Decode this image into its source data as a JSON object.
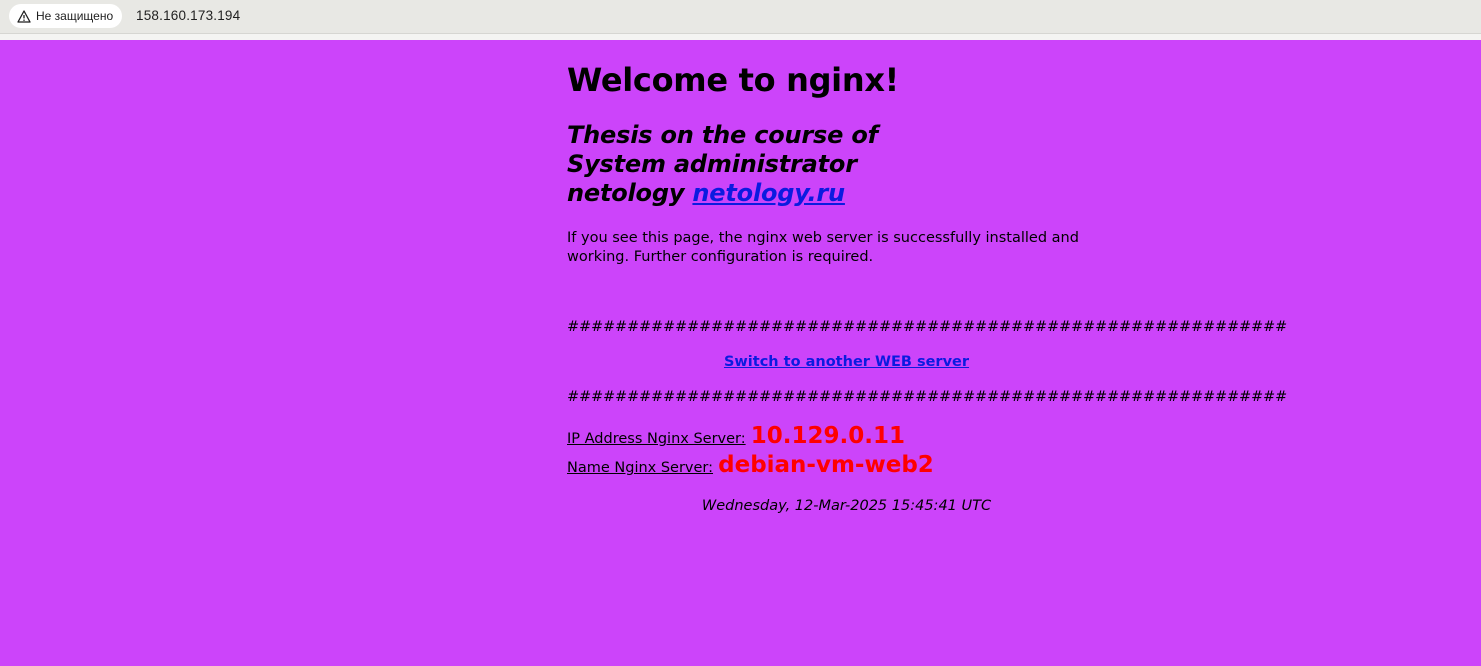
{
  "browser": {
    "security_label": "Не защищено",
    "url": "158.160.173.194"
  },
  "page": {
    "background_color": "#cc44fa",
    "heading": "Welcome to nginx!",
    "subtitle_line1": "Thesis on the course of",
    "subtitle_line2": "System administrator",
    "subtitle_line3_prefix": "netology",
    "subtitle_link": "netology.ru",
    "intro": "If you see this page, the nginx web server is successfully installed and working. Further configuration is required.",
    "divider": "############################################################",
    "switch_link": "Switch to another WEB server",
    "ip_label": "IP Address Nginx Server:",
    "ip_value": "10.129.0.11",
    "name_label": "Name Nginx Server:",
    "name_value": "debian-vm-web2",
    "timestamp": "Wednesday, 12-Mar-2025 15:45:41 UTC",
    "value_color": "#ff0000",
    "link_color": "#0b1be0"
  }
}
